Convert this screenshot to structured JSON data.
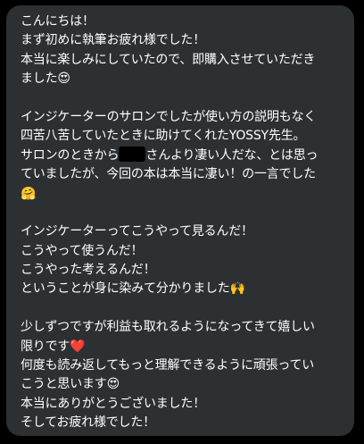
{
  "message": {
    "p1": {
      "l1": "こんにちは！",
      "l2": "まず初めに執筆お疲れ様でした！",
      "l3": "本当に楽しみにしていたので、即購入させていただき",
      "l4": "ました",
      "l4_emoji": "😍"
    },
    "p2": {
      "l1": "インジケーターのサロンでしたが使い方の説明もなく",
      "l2": "四苦八苦していたときに助けてくれたYOSSY先生。",
      "l3_a": "サロンのときから",
      "l3_b": "さんより凄い人だな、とは思っ",
      "l4": "ていましたが、今回の本は本当に凄い！の一言でした",
      "l5_emoji": "🤗"
    },
    "p3": {
      "l1": "インジケーターってこうやって見るんだ！",
      "l2": "こうやって使うんだ！",
      "l3": "こうやった考えるんだ！",
      "l4": "ということが身に染みて分かりました",
      "l4_emoji": "🙌"
    },
    "p4": {
      "l1": "少しずつですが利益も取れるようになってきて嬉しい",
      "l2": "限りです",
      "l2_emoji": "❤️",
      "l3": "何度も読み返してもっと理解できるように頑張ってい",
      "l4": "こうと思います",
      "l4_emoji": "😍",
      "l5": "本当にありがとうございました！",
      "l6": "そしてお疲れ様でした！"
    }
  },
  "colors": {
    "bubble": "#2c3033",
    "background": "#000000",
    "text": "#ffffff",
    "redaction": "#000000"
  }
}
